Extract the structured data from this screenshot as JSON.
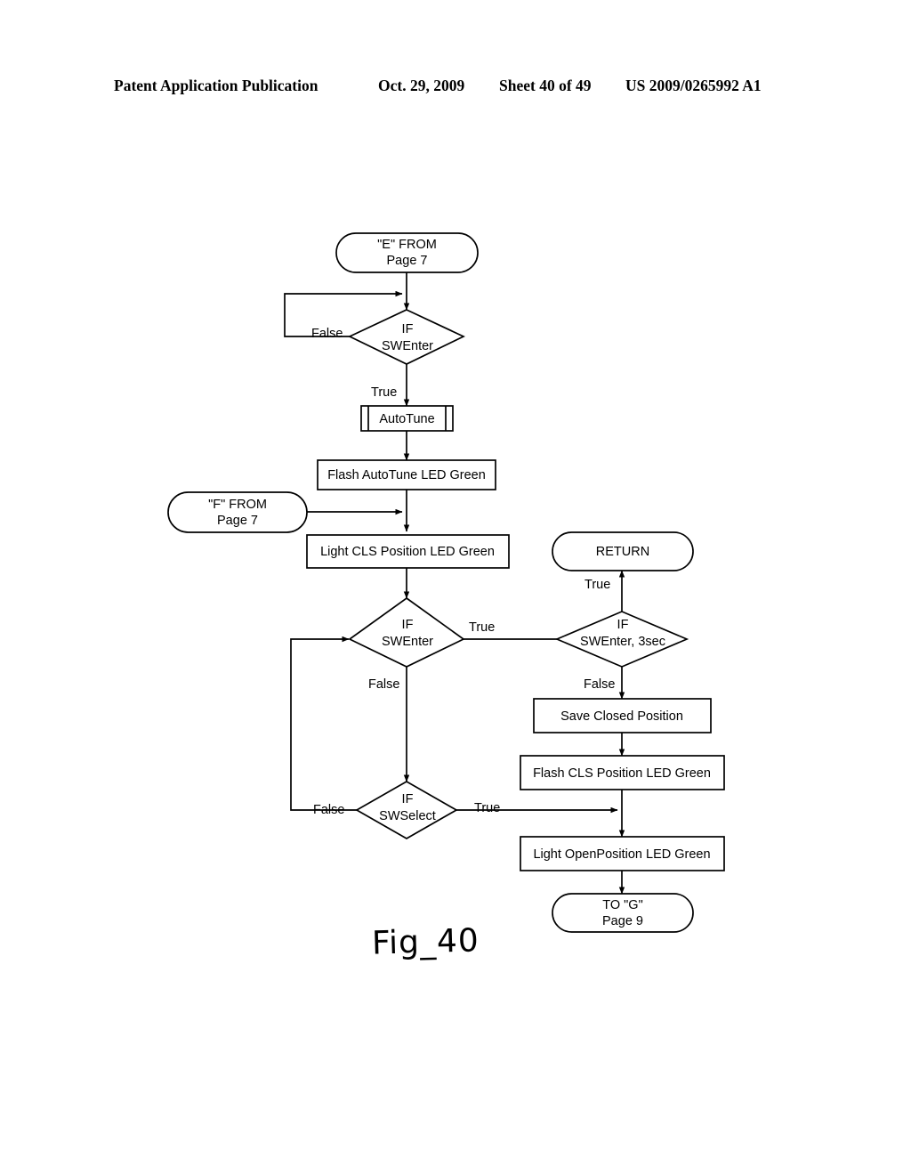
{
  "header": {
    "publication": "Patent Application Publication",
    "date": "Oct. 29, 2009",
    "sheet": "Sheet 40 of 49",
    "number": "US 2009/0265992 A1"
  },
  "figure": {
    "caption": "Fig_40"
  },
  "flowchart": {
    "nodes": {
      "entry_e": {
        "type": "terminator",
        "line1": "\"E\" FROM",
        "line2": "Page 7"
      },
      "if_swenter_1": {
        "type": "decision",
        "line1": "IF",
        "line2": "SWEnter"
      },
      "autotune": {
        "type": "predefined-process",
        "line1": "AutoTune"
      },
      "flash_autotune_led": {
        "type": "process",
        "line1": "Flash AutoTune LED Green"
      },
      "entry_f": {
        "type": "terminator",
        "line1": "\"F\" FROM",
        "line2": "Page 7"
      },
      "light_cls_led": {
        "type": "process",
        "line1": "Light CLS Position LED Green"
      },
      "if_swenter_2": {
        "type": "decision",
        "line1": "IF",
        "line2": "SWEnter"
      },
      "if_swenter_3sec": {
        "type": "decision",
        "line1": "IF",
        "line2": "SWEnter, 3sec"
      },
      "return": {
        "type": "terminator",
        "line1": "RETURN"
      },
      "save_closed_position": {
        "type": "process",
        "line1": "Save Closed Position"
      },
      "flash_cls_led": {
        "type": "process",
        "line1": "Flash CLS Position LED Green"
      },
      "if_swselect": {
        "type": "decision",
        "line1": "IF",
        "line2": "SWSelect"
      },
      "light_openposition_led": {
        "type": "process",
        "line1": "Light OpenPosition LED Green"
      },
      "exit_g": {
        "type": "terminator",
        "line1": "TO \"G\"",
        "line2": "Page 9"
      }
    },
    "edge_labels": {
      "swenter1_false": "False",
      "swenter1_true": "True",
      "swenter2_true": "True",
      "swenter2_false": "False",
      "swenter3sec_true": "True",
      "swenter3sec_false": "False",
      "swselect_false": "False",
      "swselect_true": "True"
    }
  }
}
